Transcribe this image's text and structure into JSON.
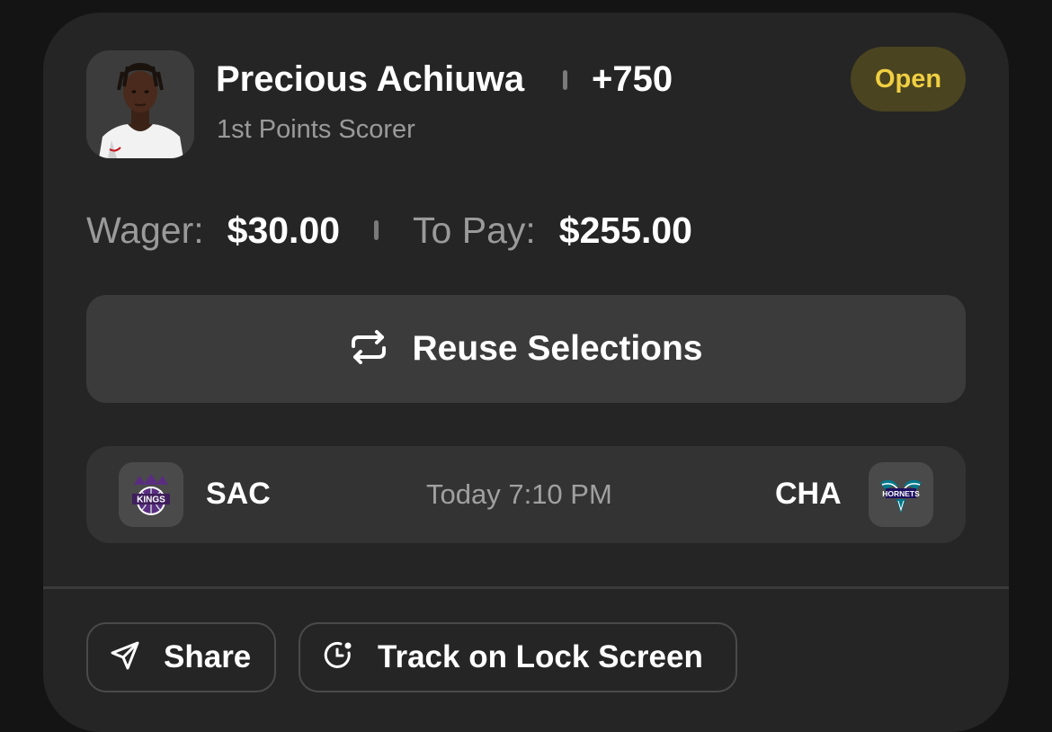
{
  "bet": {
    "player_name": "Precious Achiuwa",
    "odds": "+750",
    "market": "1st Points Scorer",
    "status": "Open",
    "wager_label": "Wager:",
    "wager_value": "$30.00",
    "topay_label": "To Pay:",
    "topay_value": "$255.00"
  },
  "actions": {
    "reuse_label": "Reuse Selections",
    "share_label": "Share",
    "track_label": "Track on Lock Screen"
  },
  "game": {
    "away_team": "SAC",
    "home_team": "CHA",
    "time": "Today 7:10 PM"
  },
  "colors": {
    "card": "#252525",
    "status_text": "#f0cf42",
    "status_bg": "#4a4420",
    "kings_purple": "#5a2d81",
    "hornets_teal": "#00788c"
  },
  "icons": {
    "reuse": "repeat-icon",
    "share": "send-icon",
    "track": "clock-icon"
  }
}
